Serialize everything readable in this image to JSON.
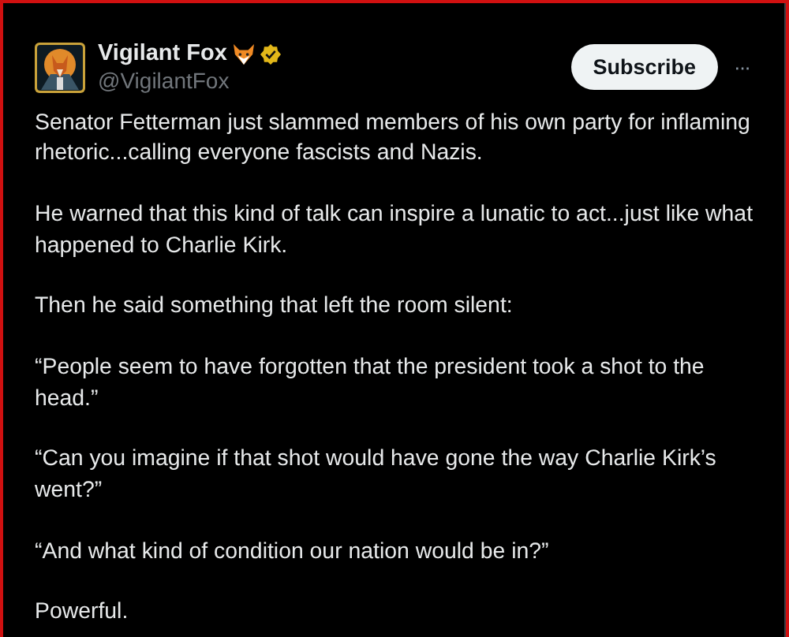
{
  "post": {
    "author": {
      "name": "Vigilant Fox",
      "verified": true,
      "handle": "@VigilantFox"
    },
    "subscribe_button": "Subscribe",
    "more_button": "···",
    "paragraphs": [
      "Senator Fetterman just slammed members of his own party for inflaming rhetoric...calling everyone fascists and Nazis.",
      "He warned that this kind of talk can inspire a lunatic to act...just like what happened to Charlie Kirk.",
      "Then he said something that left the room silent:",
      "“People seem to have forgotten that the president took a shot to the head.”",
      "“Can you imagine if that shot would have gone the way Charlie Kirk’s went?”",
      "“And what kind of condition our nation would be in?”",
      "Powerful."
    ]
  }
}
